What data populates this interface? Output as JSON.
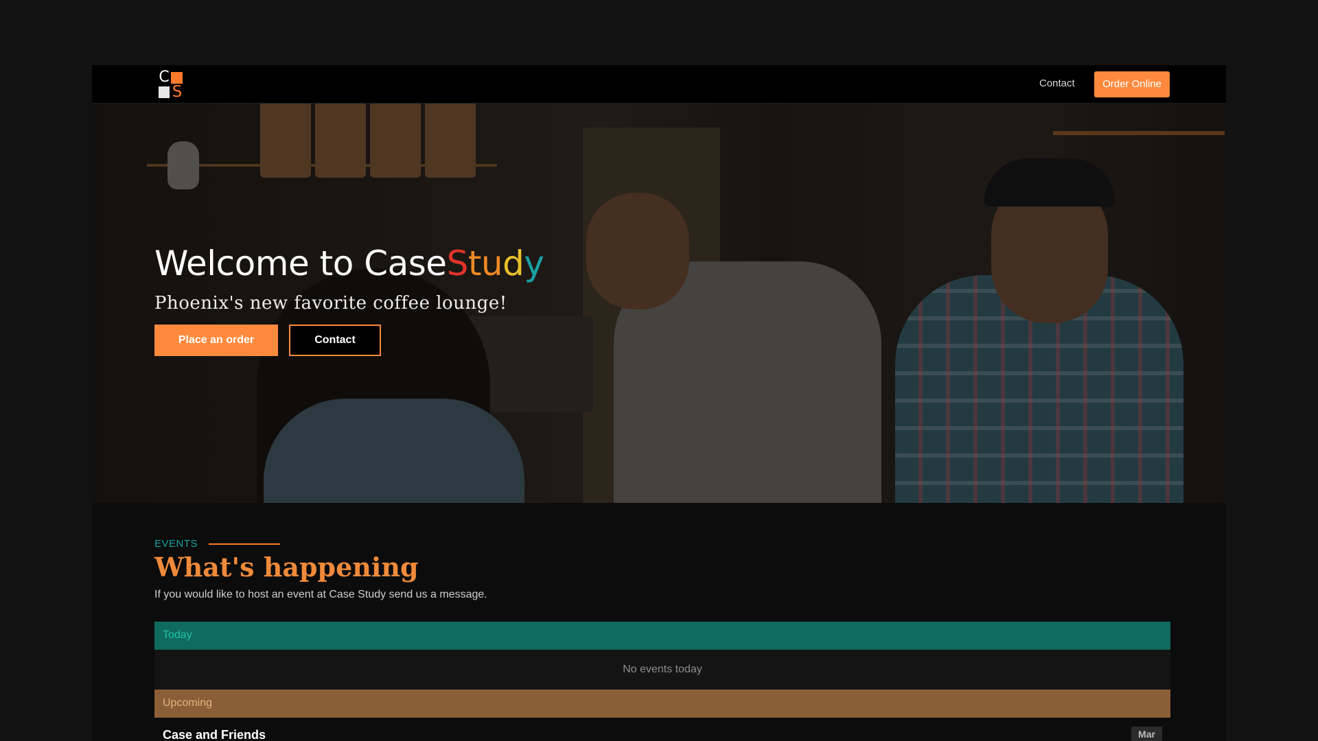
{
  "nav": {
    "logo_letters": [
      "C",
      "S"
    ],
    "contact_label": "Contact",
    "order_online_label": "Order Online"
  },
  "hero": {
    "title_prefix": "Welcome to Case",
    "title_highlight": [
      "S",
      "t",
      "u",
      "d",
      "y"
    ],
    "subtitle": "Phoenix's new favorite coffee lounge!",
    "primary_button": "Place an order",
    "secondary_button": "Contact"
  },
  "events": {
    "tag": "EVENTS",
    "title": "What's happening",
    "description": "If you would like to host an event at Case Study send us a message.",
    "today_label": "Today",
    "today_empty": "No events today",
    "upcoming_label": "Upcoming",
    "upcoming": [
      {
        "name": "Case and Friends",
        "month": "Mar"
      }
    ]
  },
  "colors": {
    "accent_orange": "#ff8a3d",
    "teal": "#1aa1a3",
    "today_bar": "#0f6b5e",
    "upcoming_bar": "#8a5f37",
    "title_red": "#e3342b",
    "title_yellow": "#e7c02a"
  }
}
